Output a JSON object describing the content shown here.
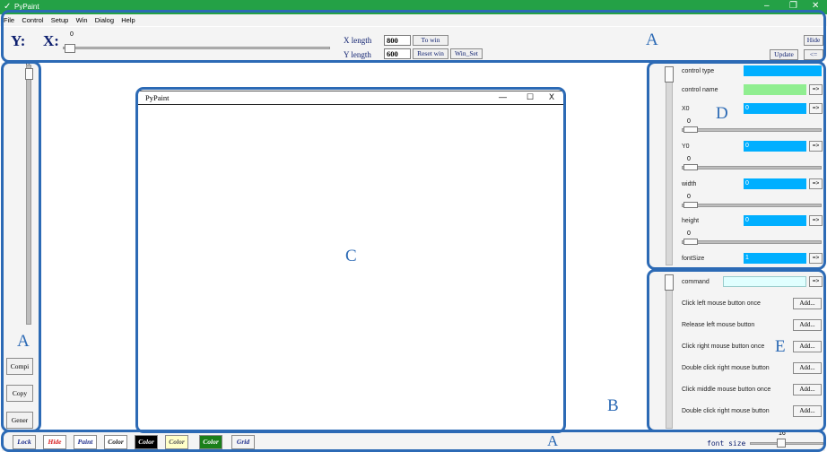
{
  "window": {
    "title": "PyPaint",
    "minimize": "–",
    "restore": "❐",
    "close": "✕"
  },
  "menu": [
    "File",
    "Control",
    "Setup",
    "Win",
    "Dialog",
    "Help"
  ],
  "toolbar": {
    "y_label": "Y:",
    "x_label": "X:",
    "x_value": "0",
    "x_length_label": "X length",
    "x_length_value": "800",
    "y_length_label": "Y length",
    "y_length_value": "600",
    "to_win": "To win",
    "reset_win": "Reset win",
    "win_set": "Win_Set",
    "hide": "Hide",
    "update": "Update",
    "back": "<="
  },
  "left_panel": {
    "slider_value": "0",
    "buttons": [
      "Compi",
      "Copy",
      "Gener"
    ]
  },
  "canvas_window": {
    "title": "PyPaint",
    "minimize": "—",
    "maximize": "☐",
    "close": "X"
  },
  "properties": {
    "control_type": {
      "label": "control type",
      "value": ""
    },
    "control_name": {
      "label": "control name",
      "value": ""
    },
    "x0": {
      "label": "X0",
      "value": "0",
      "slider": "0"
    },
    "y0": {
      "label": "Y0",
      "value": "0",
      "slider": "0"
    },
    "width": {
      "label": "width",
      "value": "0",
      "slider": "0"
    },
    "height": {
      "label": "height",
      "value": "0",
      "slider": "0"
    },
    "font_size": {
      "label": "fontSize",
      "value": "1"
    },
    "arrow": "=>"
  },
  "commands": {
    "label": "command",
    "arrow": "=>",
    "add": "Add...",
    "items": [
      "Click left mouse button once",
      "Release left mouse button",
      "Click right mouse button once",
      "Double click right mouse button",
      "Click middle mouse button once",
      "Double click right mouse button"
    ]
  },
  "bottom_bar": {
    "buttons": [
      {
        "label": "Lock",
        "bg": "#f4f4f4",
        "fg": "#1a2a8a"
      },
      {
        "label": "Hide",
        "bg": "#ffffff",
        "fg": "#d82020"
      },
      {
        "label": "Paint",
        "bg": "#ffffff",
        "fg": "#1a2a8a"
      },
      {
        "label": "Color",
        "bg": "#ffffff",
        "fg": "#222222"
      },
      {
        "label": "Color",
        "bg": "#000000",
        "fg": "#ffffff"
      },
      {
        "label": "Color",
        "bg": "#ffffc8",
        "fg": "#555555"
      },
      {
        "label": "Color",
        "bg": "#1a7f1a",
        "fg": "#ffffff"
      },
      {
        "label": "Grid",
        "bg": "#f4f4f4",
        "fg": "#1a2a8a"
      }
    ],
    "font_size_label": "font size",
    "font_size_value": "16"
  },
  "annotations": {
    "a": "A",
    "b": "B",
    "c": "C",
    "d": "D",
    "e": "E"
  },
  "colors": {
    "title_bar": "#24a146",
    "annotation_blue": "#2c6ab5",
    "field_blue": "#00afff",
    "field_green": "#90ee90",
    "field_cyan": "#e0ffff"
  }
}
